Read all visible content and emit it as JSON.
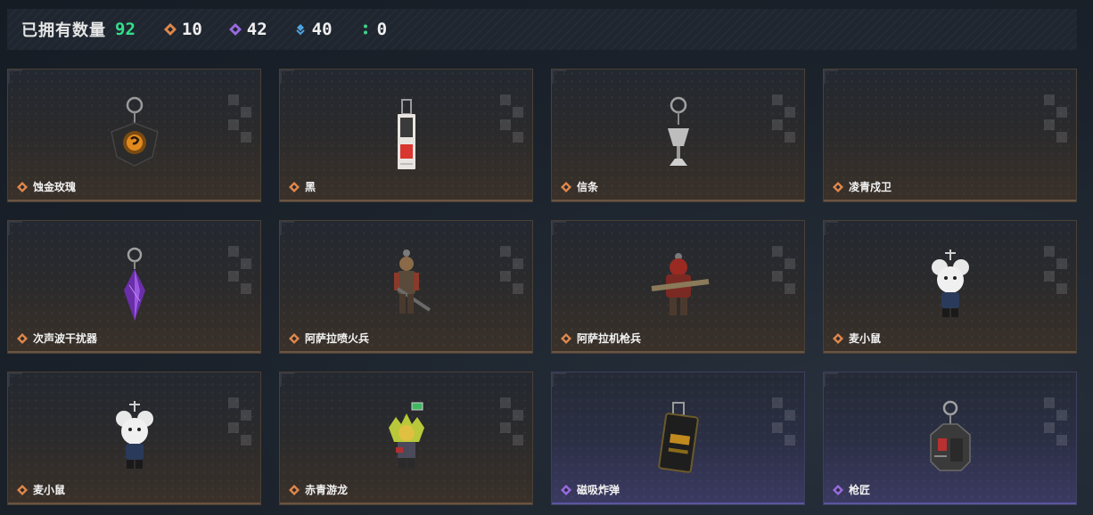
{
  "header": {
    "owned_label": "已拥有数量",
    "owned_count": "92",
    "stats": [
      {
        "icon": "orange-diamond-icon",
        "color": "#e0874a",
        "value": "10"
      },
      {
        "icon": "purple-diamond-icon",
        "color": "#9a6be0",
        "value": "42"
      },
      {
        "icon": "blue-diamond-icon",
        "color": "#4fa3e0",
        "value": "40"
      },
      {
        "icon": "green-dots-icon",
        "color": "#3fd38a",
        "value": "0"
      }
    ]
  },
  "items": [
    {
      "name": "蚀金玫瑰",
      "rarity": "orange",
      "art": "rose"
    },
    {
      "name": "黑",
      "rarity": "orange",
      "art": "tag"
    },
    {
      "name": "信条",
      "rarity": "orange",
      "art": "chalice"
    },
    {
      "name": "凌青戍卫",
      "rarity": "orange",
      "art": "none"
    },
    {
      "name": "次声波干扰器",
      "rarity": "orange",
      "art": "crystal"
    },
    {
      "name": "阿萨拉喷火兵",
      "rarity": "orange",
      "art": "soldier-flame"
    },
    {
      "name": "阿萨拉机枪兵",
      "rarity": "orange",
      "art": "soldier-gun"
    },
    {
      "name": "麦小鼠",
      "rarity": "orange",
      "art": "mouse"
    },
    {
      "name": "麦小鼠",
      "rarity": "orange",
      "art": "mouse"
    },
    {
      "name": "赤青游龙",
      "rarity": "orange",
      "art": "dragon"
    },
    {
      "name": "磁吸炸弹",
      "rarity": "purple",
      "art": "bomb"
    },
    {
      "name": "枪匠",
      "rarity": "purple",
      "art": "gunsmith"
    }
  ],
  "colors": {
    "orange": "#e0874a",
    "purple": "#9a6be0",
    "accent_green": "#33e08a"
  }
}
